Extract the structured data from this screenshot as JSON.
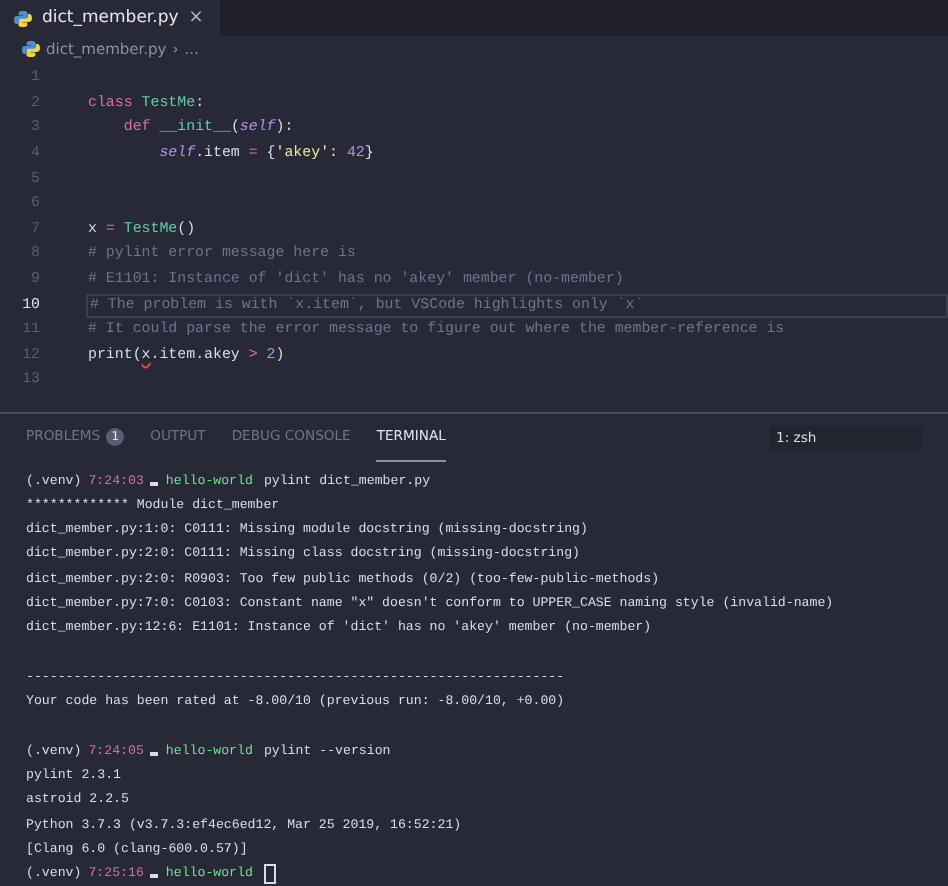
{
  "tabs": [
    {
      "label": "dict_member.py",
      "selected": true,
      "close": "×"
    }
  ],
  "breadcrumb": {
    "file": "dict_member.py",
    "separator": "›",
    "rest": "..."
  },
  "editor": {
    "lines": [
      {
        "number": "1",
        "current": false
      },
      {
        "number": "2",
        "current": false,
        "tokens": [
          {
            "kind": "keyword",
            "text": "class "
          },
          {
            "kind": "name",
            "text": "TestMe"
          },
          {
            "kind": "plain",
            "text": ":"
          }
        ]
      },
      {
        "number": "3",
        "current": false,
        "tokens": [
          {
            "kind": "keyword",
            "text": "    def "
          },
          {
            "kind": "name",
            "text": "__init__"
          },
          {
            "kind": "plain",
            "text": "("
          },
          {
            "kind": "self",
            "text": "self"
          },
          {
            "kind": "plain",
            "text": "):"
          }
        ]
      },
      {
        "number": "4",
        "current": false,
        "tokens": [
          {
            "kind": "self",
            "text": "        self"
          },
          {
            "kind": "plain",
            "text": ".item "
          },
          {
            "kind": "operator",
            "text": "="
          },
          {
            "kind": "plain",
            "text": " {"
          },
          {
            "kind": "string",
            "text": "'akey'"
          },
          {
            "kind": "plain",
            "text": ": "
          },
          {
            "kind": "number",
            "text": "42"
          },
          {
            "kind": "plain",
            "text": "}"
          }
        ]
      },
      {
        "number": "5",
        "current": false
      },
      {
        "number": "6",
        "current": false
      },
      {
        "number": "7",
        "current": false,
        "tokens": [
          {
            "kind": "plain",
            "text": "x "
          },
          {
            "kind": "operator",
            "text": "="
          },
          {
            "kind": "name",
            "text": " TestMe"
          },
          {
            "kind": "plain",
            "text": "()"
          }
        ]
      },
      {
        "number": "8",
        "current": false,
        "tokens": [
          {
            "kind": "comment",
            "text": "# pylint error message here is"
          }
        ]
      },
      {
        "number": "9",
        "current": false,
        "tokens": [
          {
            "kind": "comment",
            "text": "# E1101: Instance of 'dict' has no 'akey' member (no-member)"
          }
        ]
      },
      {
        "number": "10",
        "current": true,
        "tokens": [
          {
            "kind": "comment",
            "text": "# The problem is with `x.item`, but VSCode highlights only `x`"
          }
        ]
      },
      {
        "number": "11",
        "current": false,
        "tokens": [
          {
            "kind": "comment",
            "text": "# It could parse the error message to figure out where the member-reference is"
          }
        ]
      },
      {
        "number": "12",
        "current": false,
        "tokens": [
          {
            "kind": "plain",
            "text": "print("
          },
          {
            "kind": "error",
            "text": "x"
          },
          {
            "kind": "plain",
            "text": ".item.akey "
          },
          {
            "kind": "operator",
            "text": "> "
          },
          {
            "kind": "number",
            "text": "2"
          },
          {
            "kind": "plain",
            "text": ")"
          }
        ]
      },
      {
        "number": "13",
        "current": false
      }
    ]
  },
  "panel": {
    "tabs": [
      {
        "label": "PROBLEMS",
        "badge": "1",
        "selected": false
      },
      {
        "label": "OUTPUT",
        "selected": false
      },
      {
        "label": "DEBUG CONSOLE",
        "selected": false
      },
      {
        "label": "TERMINAL",
        "selected": true
      }
    ],
    "terminal_select": "1: zsh",
    "terminal": [
      {
        "kind": "prompt",
        "venv": "(.venv)",
        "time": "7:24:03",
        "dir": "hello-world",
        "command": "pylint dict_member.py"
      },
      {
        "kind": "output",
        "text": "************* Module dict_member"
      },
      {
        "kind": "output",
        "text": "dict_member.py:1:0: C0111: Missing module docstring (missing-docstring)"
      },
      {
        "kind": "output",
        "text": "dict_member.py:2:0: C0111: Missing class docstring (missing-docstring)"
      },
      {
        "kind": "output",
        "text": "dict_member.py:2:0: R0903: Too few public methods (0/2) (too-few-public-methods)"
      },
      {
        "kind": "output",
        "text": "dict_member.py:7:0: C0103: Constant name \"x\" doesn't conform to UPPER_CASE naming style (invalid-name)"
      },
      {
        "kind": "output",
        "text": "dict_member.py:12:6: E1101: Instance of 'dict' has no 'akey' member (no-member)"
      },
      {
        "kind": "blank"
      },
      {
        "kind": "output",
        "text": "--------------------------------------------------------------------"
      },
      {
        "kind": "output",
        "text": "Your code has been rated at -8.00/10 (previous run: -8.00/10, +0.00)"
      },
      {
        "kind": "blank"
      },
      {
        "kind": "prompt",
        "venv": "(.venv)",
        "time": "7:24:05",
        "dir": "hello-world",
        "command": "pylint --version"
      },
      {
        "kind": "output",
        "text": "pylint 2.3.1"
      },
      {
        "kind": "output",
        "text": "astroid 2.2.5"
      },
      {
        "kind": "output",
        "text": "Python 3.7.3 (v3.7.3:ef4ec6ed12, Mar 25 2019, 16:52:21)"
      },
      {
        "kind": "output",
        "text": "[Clang 6.0 (clang-600.0.57)]"
      },
      {
        "kind": "prompt",
        "venv": "(.venv)",
        "time": "7:25:16",
        "dir": "hello-world",
        "cursor": true
      }
    ]
  }
}
